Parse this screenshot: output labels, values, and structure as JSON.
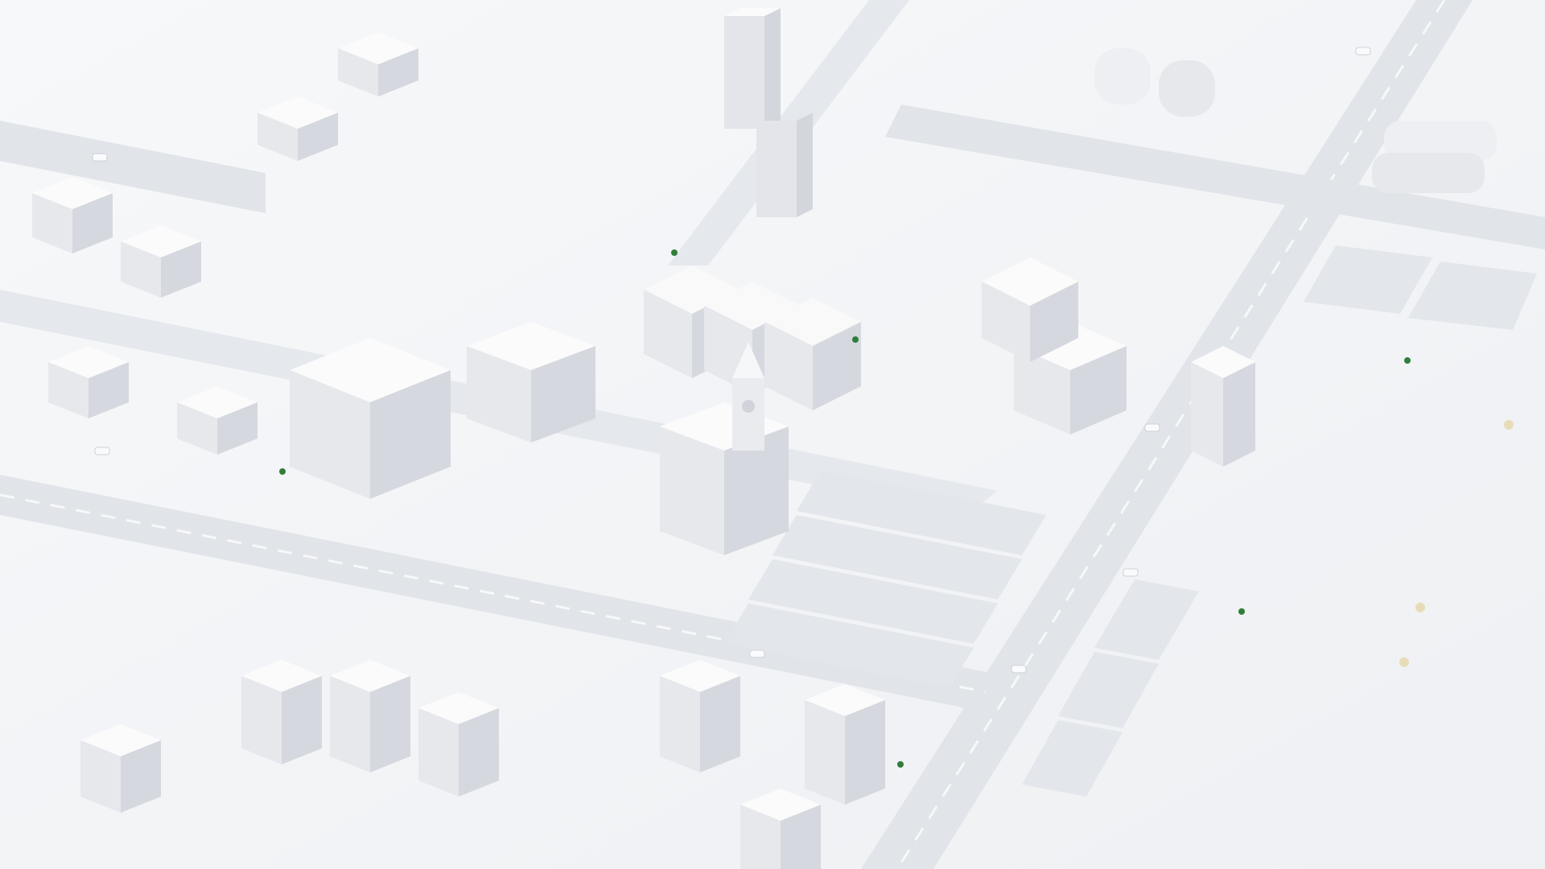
{
  "scene": {
    "description_visible_text": "",
    "colors": {
      "background": "#f4f5f7",
      "ground": "#eceef1",
      "road": "#dfe2e6",
      "road_line": "#f7f8fa",
      "lot": "#e3e6ea",
      "building_top": "#fbfbfc",
      "building_left": "#e6e8ec",
      "building_right": "#d5d8de",
      "shadow": "#cfd3da",
      "tree_accent": "#2f7d3a",
      "warm_accent": "#e8dcb8"
    }
  }
}
